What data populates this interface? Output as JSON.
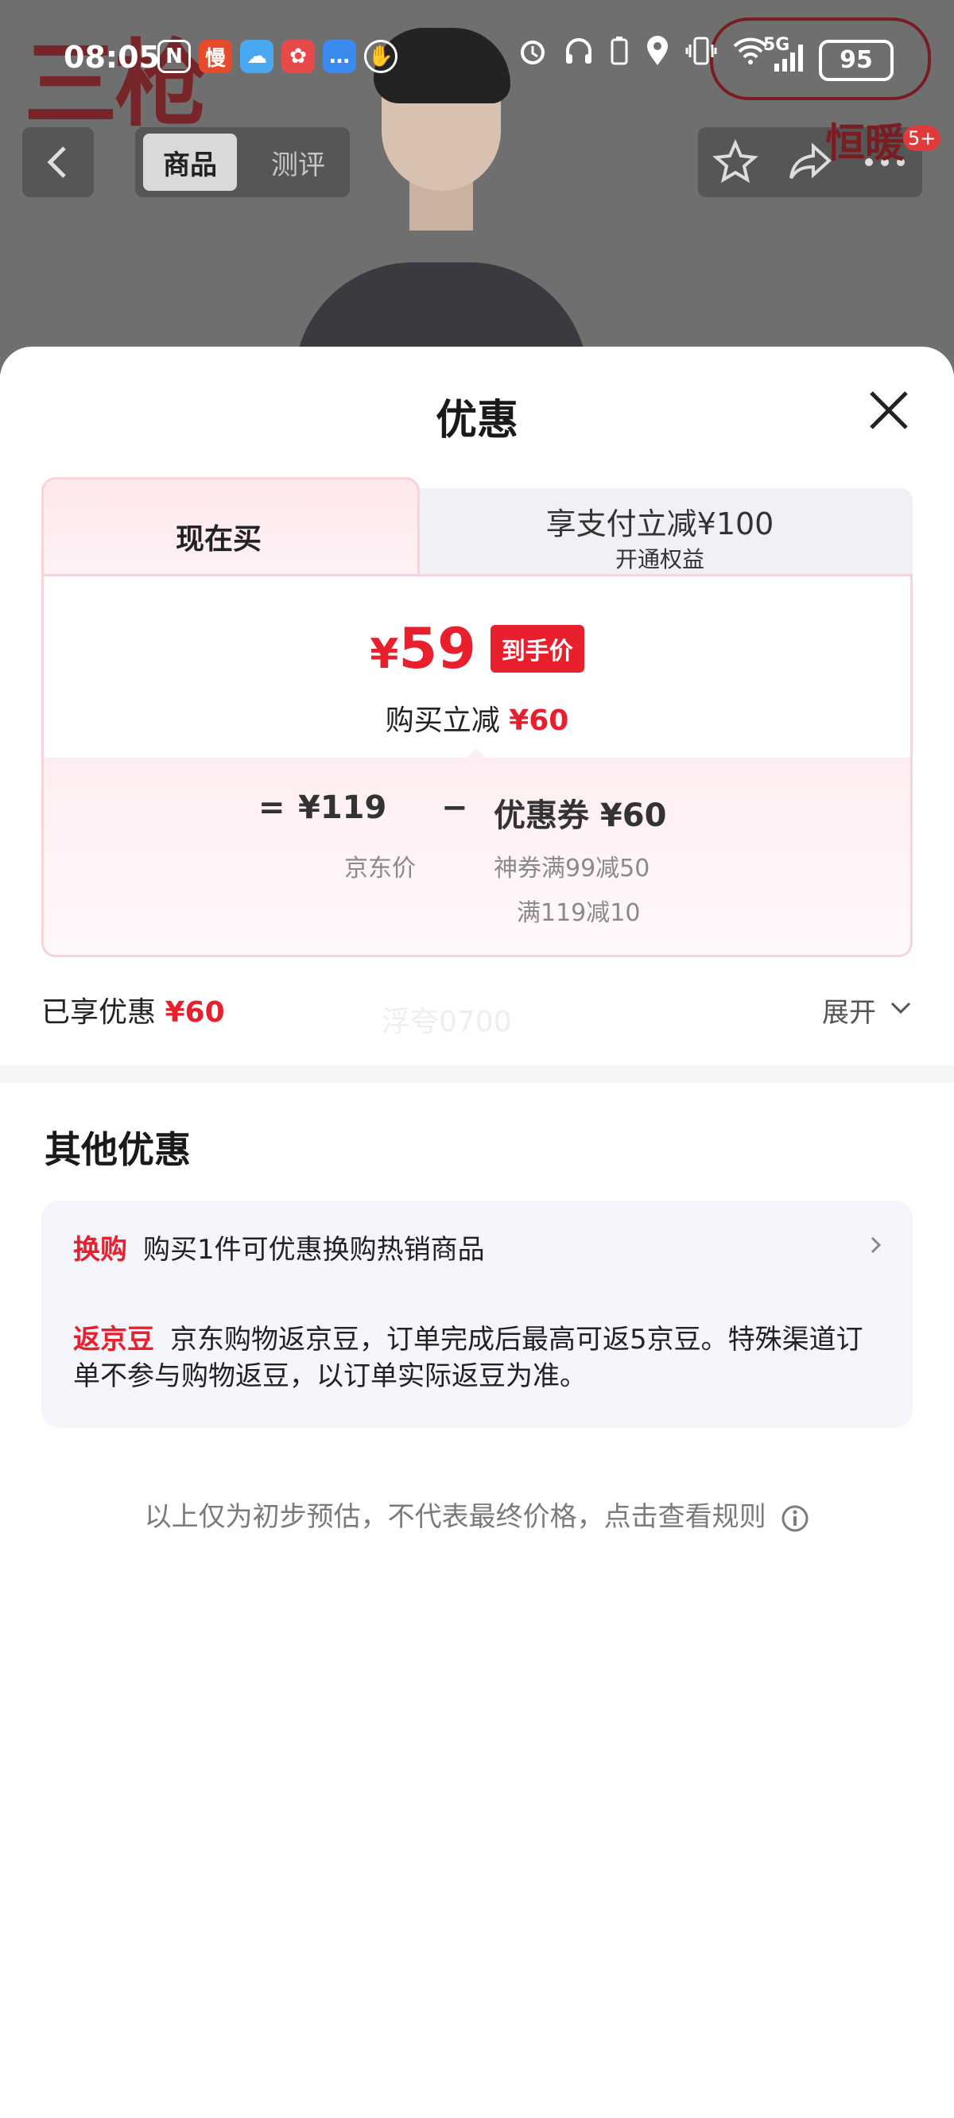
{
  "status_bar": {
    "time": "08:05",
    "app_icons": [
      "N",
      "慢",
      "☁",
      "✿",
      "…",
      "✋"
    ],
    "network": "5G",
    "battery": "95"
  },
  "background": {
    "brand_text": "三枪",
    "brand_mark": "恒暖",
    "badge": "5+"
  },
  "top_nav": {
    "tabs": [
      "商品",
      "测评"
    ]
  },
  "sheet": {
    "title": "优惠",
    "tabs": {
      "active": "现在买",
      "inactive_title": "享支付立减¥100",
      "inactive_sub": "开通权益"
    },
    "final_price": {
      "yen": "¥",
      "amount": "59",
      "tag": "到手价"
    },
    "reduction": {
      "label": "购买立减",
      "amount": "¥60"
    },
    "formula": {
      "equals": "=",
      "jd_price": "¥119",
      "minus": "−",
      "coupon": "优惠券 ¥60",
      "jd_price_label": "京东价",
      "coupon_detail_1": "神券满99减50",
      "coupon_detail_2": "满119减10"
    },
    "enjoyed": {
      "label": "已享优惠",
      "amount": "¥60"
    },
    "watermark": "浮夸0700",
    "expand_label": "展开",
    "other": {
      "title": "其他优惠",
      "items": [
        {
          "tag": "换购",
          "text": "购买1件可优惠换购热销商品"
        },
        {
          "tag": "返京豆",
          "text": "京东购物返京豆，订单完成后最高可返5京豆。特殊渠道订单不参与购物返豆，以订单实际返豆为准。"
        }
      ]
    },
    "disclaimer": "以上仅为初步预估，不代表最终价格，点击查看规则"
  },
  "colors": {
    "accent_red": "#e8202e",
    "tab_border": "#f7d3da"
  }
}
